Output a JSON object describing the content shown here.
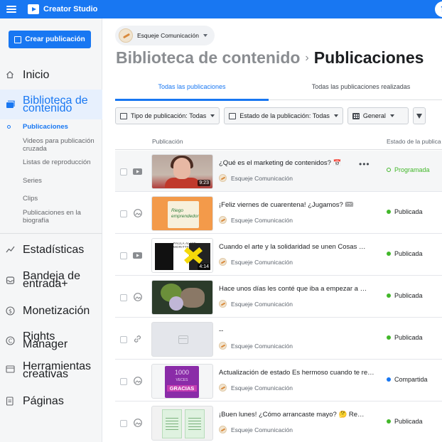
{
  "app": {
    "title": "Creator Studio"
  },
  "sidebar": {
    "create_label": "Crear publicación",
    "items": [
      {
        "label": "Inicio",
        "icon": "home-icon"
      },
      {
        "label": "Biblioteca de contenido",
        "icon": "library-icon"
      },
      {
        "label": "Estadísticas",
        "icon": "insights-icon"
      },
      {
        "label": "Bandeja de entrada+",
        "icon": "inbox-icon"
      },
      {
        "label": "Monetización",
        "icon": "dollar-icon"
      },
      {
        "label": "Rights Manager",
        "icon": "copyright-icon"
      },
      {
        "label": "Herramientas creativas",
        "icon": "tools-icon"
      },
      {
        "label": "Páginas",
        "icon": "pages-icon"
      }
    ],
    "subitems": [
      "Publicaciones",
      "Videos para publicación cruzada",
      "Listas de reproducción",
      "Series",
      "Clips",
      "Publicaciones en la biografía"
    ]
  },
  "page_selector": {
    "name": "Esqueje Comunicación"
  },
  "header": {
    "library": "Biblioteca de contenido",
    "separator": "›",
    "current": "Publicaciones"
  },
  "tabs": [
    "Todas las publicaciones",
    "Todas las publicaciones realizadas"
  ],
  "filters": {
    "type_label": "Tipo de publicación:",
    "type_value": "Todas",
    "status_label": "Estado de la publicación:",
    "status_value": "Todas",
    "view_label": "General"
  },
  "table": {
    "col_publication": "Publicación",
    "col_status": "Estado de la publica",
    "rows": [
      {
        "title": "¿Qué es el marketing de contenidos? 📅",
        "page": "Esqueje Comunicación",
        "status": "Programada",
        "type": "video",
        "duration": "9:23"
      },
      {
        "title": "¡Feliz viernes de cuarentena! ¿Jugamos? 🎟",
        "page": "Esqueje Comunicación",
        "status": "Publicada",
        "type": "photo",
        "thumb_text": "Riego emprendedor"
      },
      {
        "title": "Cuando el arte y la solidaridad se unen Cosas …",
        "page": "Esqueje Comunicación",
        "status": "Publicada",
        "type": "video",
        "duration": "4:14",
        "thumb_text": "PAULA ALAMI MORITTE"
      },
      {
        "title": "Hace unos días les conté que iba a empezar a …",
        "page": "Esqueje Comunicación",
        "status": "Publicada",
        "type": "photo"
      },
      {
        "title": "--",
        "page": "Esqueje Comunicación",
        "status": "Publicada",
        "type": "link"
      },
      {
        "title": "Actualización de estado Es hermoso cuando te re…",
        "page": "Esqueje Comunicación",
        "status": "Compartida",
        "type": "photo",
        "thumb_lines": [
          "1000",
          "VECES",
          "GRACIAS"
        ]
      },
      {
        "title": "¡Buen lunes! ¿Cómo arrancaste mayo? 🤔 Re…",
        "page": "Esqueje Comunicación",
        "status": "Publicada",
        "type": "photo"
      }
    ]
  },
  "colors": {
    "brand": "#1877f2",
    "published": "#42b72a",
    "shared": "#1877f2"
  }
}
